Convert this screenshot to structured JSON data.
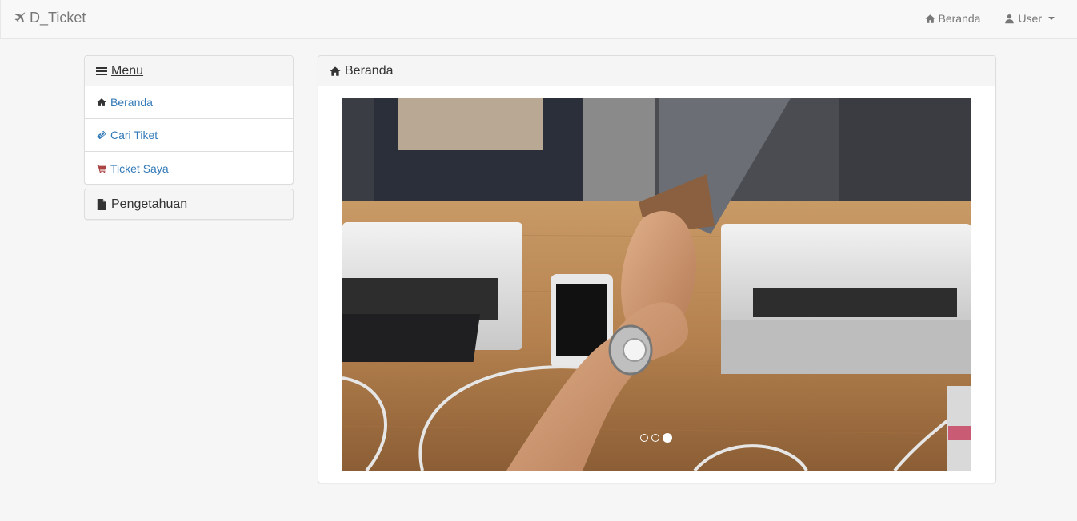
{
  "navbar": {
    "brand": "D_Ticket",
    "brand_icon": "plane-icon",
    "home_label": "Beranda",
    "user_label": "User"
  },
  "sidebar": {
    "menu_title": "Menu",
    "items": [
      {
        "label": "Beranda",
        "icon": "home-icon",
        "color": "#333333"
      },
      {
        "label": "Cari Tiket",
        "icon": "ticket-icon",
        "color": "#337ab7"
      },
      {
        "label": "Ticket Saya",
        "icon": "cart-icon",
        "color": "#a94442"
      }
    ],
    "knowledge_title": "Pengetahuan"
  },
  "main": {
    "title": "Beranda",
    "carousel": {
      "slide_count": 3,
      "active_index": 2
    }
  },
  "colors": {
    "link": "#337ab7",
    "navbar_text": "#777777"
  }
}
